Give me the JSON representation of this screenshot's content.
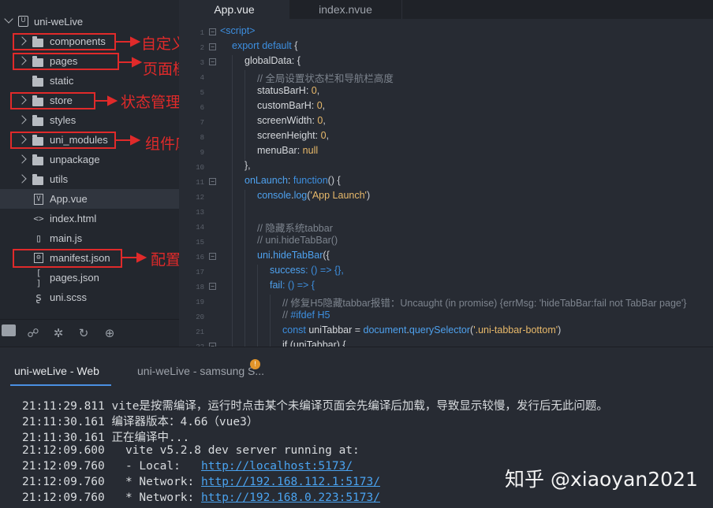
{
  "sidebar": {
    "root": "uni-weLive",
    "items": [
      {
        "label": "components",
        "kind": "folder"
      },
      {
        "label": "pages",
        "kind": "folder"
      },
      {
        "label": "static",
        "kind": "folder"
      },
      {
        "label": "store",
        "kind": "folder"
      },
      {
        "label": "styles",
        "kind": "folder"
      },
      {
        "label": "uni_modules",
        "kind": "folder"
      },
      {
        "label": "unpackage",
        "kind": "folder"
      },
      {
        "label": "utils",
        "kind": "folder"
      },
      {
        "label": "App.vue",
        "kind": "file",
        "icon": "V"
      },
      {
        "label": "index.html",
        "kind": "file",
        "icon": "<>"
      },
      {
        "label": "main.js",
        "kind": "file",
        "icon": "▯"
      },
      {
        "label": "manifest.json",
        "kind": "file",
        "icon": "⚙"
      },
      {
        "label": "pages.json",
        "kind": "file",
        "icon": "[ ]"
      },
      {
        "label": "uni.scss",
        "kind": "file",
        "icon": "ʂ"
      }
    ]
  },
  "annotations": {
    "components": "自定义组件",
    "pages": "页面模板",
    "store": "状态管理",
    "uni_modules": "组件库",
    "manifest": "配置文件"
  },
  "toolbar_icons": [
    "file-tree-icon",
    "binoculars-icon",
    "bug-icon",
    "refresh-icon",
    "plugin-icon"
  ],
  "editor": {
    "tabs": [
      "App.vue",
      "index.nvue"
    ],
    "line_numbers": [
      "1",
      "2",
      "3",
      "4",
      "5",
      "6",
      "7",
      "8",
      "9",
      "10",
      "11",
      "12",
      "13",
      "14",
      "15",
      "16",
      "17",
      "18",
      "19",
      "20",
      "21",
      "22"
    ],
    "code": {
      "l1": "<script>",
      "l2_a": "export default",
      "l2_b": " {",
      "l3": "globalData: {",
      "l4": "// 全局设置状态栏和导航栏高度",
      "l5_a": "statusBarH: ",
      "l5_b": "0",
      "l5_c": ",",
      "l6_a": "customBarH: ",
      "l6_b": "0",
      "l6_c": ",",
      "l7_a": "screenWidth: ",
      "l7_b": "0",
      "l7_c": ",",
      "l8_a": "screenHeight: ",
      "l8_b": "0",
      "l8_c": ",",
      "l9_a": "menuBar: ",
      "l9_b": "null",
      "l10": "},",
      "l11_a": "onLaunch",
      "l11_b": ": ",
      "l11_c": "function",
      "l11_d": "() {",
      "l12_a": "console",
      "l12_b": ".",
      "l12_c": "log",
      "l12_d": "(",
      "l12_e": "'App Launch'",
      "l12_f": ")",
      "l14": "// 隐藏系统tabbar",
      "l15": "// uni.hideTabBar()",
      "l16_a": "uni",
      "l16_b": ".",
      "l16_c": "hideTabBar",
      "l16_d": "({",
      "l17_a": "success",
      "l17_b": ": () => {},",
      "l18_a": "fail",
      "l18_b": ": () => {",
      "l19": "// 修复H5隐藏tabbar报错：Uncaught (in promise) {errMsg: 'hideTabBar:fail not TabBar page'}",
      "l20_a": "// ",
      "l20_b": "#ifdef H5",
      "l21_a": "const ",
      "l21_b": "uniTabbar",
      "l21_c": " = ",
      "l21_d": "document",
      "l21_e": ".",
      "l21_f": "querySelector",
      "l21_g": "(",
      "l21_h": "'.uni-tabbar-bottom'",
      "l21_i": ")",
      "l22": "if (uniTabbar) {"
    }
  },
  "console": {
    "tabs": [
      "uni-weLive - Web",
      "uni-weLive - samsung S..."
    ],
    "badge": "!",
    "logs": [
      {
        "time": "21:11:29.811",
        "text": "vite是按需编译，运行时点击某个未编译页面会先编译后加载，导致显示较慢，发行后无此问题。"
      },
      {
        "time": "21:11:30.161",
        "text": "编译器版本：4.66（vue3）"
      },
      {
        "time": "21:11:30.161",
        "text": "正在编译中..."
      },
      {
        "time": "21:12:09.600",
        "text": "  vite v5.2.8 dev server running at:"
      },
      {
        "time": "21:12:09.760",
        "text": "  - Local:   ",
        "link": "http://localhost:5173/"
      },
      {
        "time": "21:12:09.760",
        "text": "  * Network: ",
        "link": "http://192.168.112.1:5173/"
      },
      {
        "time": "21:12:09.760",
        "text": "  * Network: ",
        "link": "http://192.168.0.223:5173/"
      }
    ]
  },
  "watermark": "知乎 @xiaoyan2021",
  "colors": {
    "annotation_red": "#e02a2a",
    "accent_blue": "#4a90e2",
    "badge_orange": "#e2942a"
  }
}
